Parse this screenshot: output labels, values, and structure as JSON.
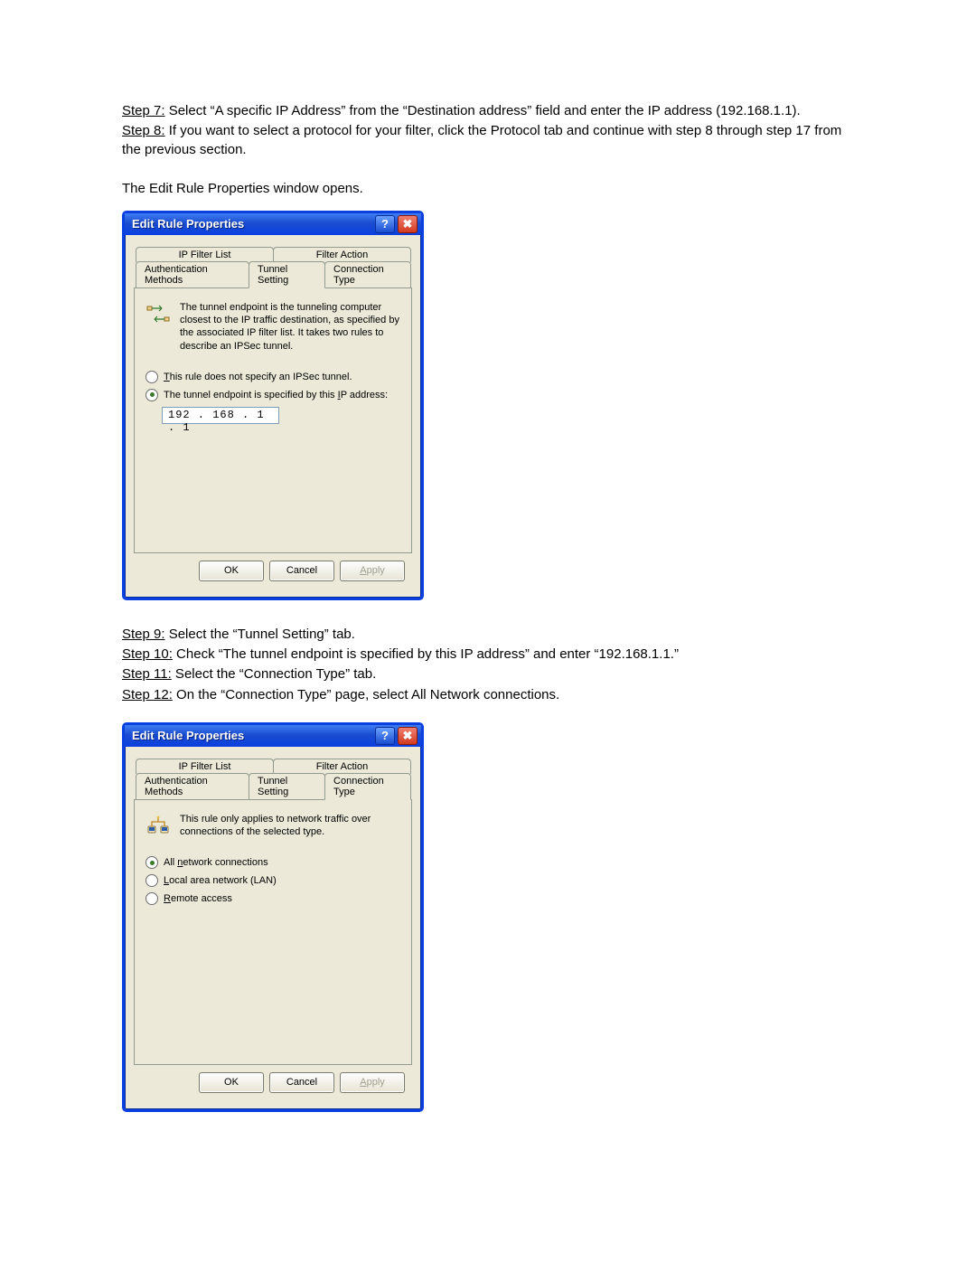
{
  "steps_top": [
    {
      "label": "Step 7:",
      "text": " Select “A specific IP Address” from the “Destination address” field and enter the IP address (192.168.1.1)."
    },
    {
      "label": "Step 8:",
      "text": " If you want to select a protocol for your filter, click the Protocol tab and continue with step 8 through step 17 from the previous section."
    }
  ],
  "intro_text": "The Edit Rule Properties window opens.",
  "steps_mid": [
    {
      "label": "Step 9:",
      "text": " Select the “Tunnel Setting” tab."
    },
    {
      "label": "Step 10:",
      "text": " Check “The tunnel endpoint is specified by this IP address” and enter “192.168.1.1.”"
    },
    {
      "label": "Step 11:",
      "text": " Select the “Connection Type” tab."
    },
    {
      "label": "Step 12:",
      "text": " On the “Connection Type” page, select All Network connections."
    }
  ],
  "dialog_title": "Edit Rule Properties",
  "tabs": {
    "ip_filter_list": "IP Filter List",
    "filter_action": "Filter Action",
    "auth_methods": "Authentication Methods",
    "tunnel_setting": "Tunnel Setting",
    "connection_type": "Connection Type"
  },
  "tunnel_panel": {
    "info": "The tunnel endpoint is the tunneling computer closest to the IP traffic destination, as specified by the associated IP filter list. It takes two rules to describe an IPSec tunnel.",
    "radio_no_tunnel_pre": "T",
    "radio_no_tunnel_rest": "his rule does not specify an IPSec tunnel.",
    "radio_specify_pre": "The tunnel endpoint is specified by this ",
    "radio_specify_ul": "I",
    "radio_specify_post": "P address:",
    "ip_value": "192 . 168 .   1   .   1"
  },
  "conn_panel": {
    "info": "This rule only applies to network traffic over connections of the selected type.",
    "radio_all_pre": "All ",
    "radio_all_ul": "n",
    "radio_all_post": "etwork connections",
    "radio_lan_ul": "L",
    "radio_lan_post": "ocal area network (LAN)",
    "radio_remote_ul": "R",
    "radio_remote_post": "emote access"
  },
  "buttons": {
    "ok": "OK",
    "cancel": "Cancel",
    "apply_ul": "A",
    "apply_post": "pply"
  }
}
